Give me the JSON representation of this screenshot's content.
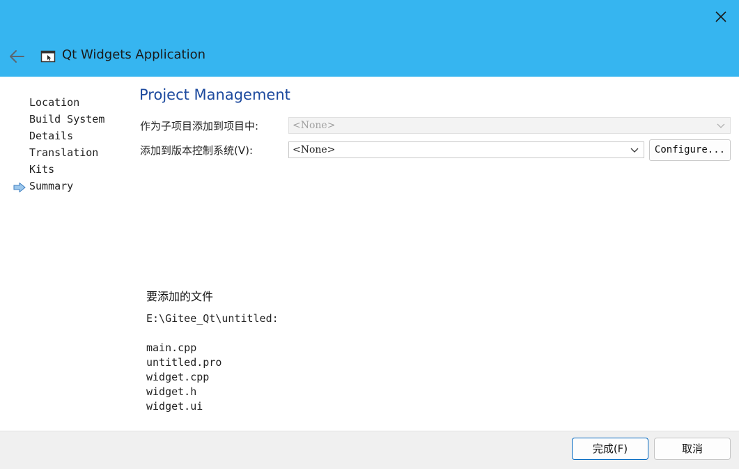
{
  "window": {
    "title": "Qt Widgets Application",
    "back_icon": "arrow-left-icon",
    "close_icon": "close-icon",
    "app_icon": "qt-app-window-icon",
    "accent_color": "#36b5f0"
  },
  "sidebar": {
    "current_marker_icon": "arrow-right-icon",
    "steps": [
      {
        "label": "Location"
      },
      {
        "label": "Build System"
      },
      {
        "label": "Details"
      },
      {
        "label": "Translation"
      },
      {
        "label": "Kits"
      },
      {
        "label": "Summary",
        "current": true
      }
    ]
  },
  "main": {
    "title": "Project Management",
    "title_color": "#1d4a9e",
    "subproject": {
      "label": "作为子项目添加到项目中:",
      "value": "<None>",
      "enabled": false
    },
    "vcs": {
      "label": "添加到版本控制系统(V):",
      "value": "<None>",
      "configure_label": "Configure..."
    },
    "files": {
      "heading": "要添加的文件",
      "path": "E:\\Gitee_Qt\\untitled:",
      "items": [
        "main.cpp",
        "untitled.pro",
        "widget.cpp",
        "widget.h",
        "widget.ui"
      ]
    }
  },
  "footer": {
    "finish_label": "完成(F)",
    "cancel_label": "取消"
  }
}
